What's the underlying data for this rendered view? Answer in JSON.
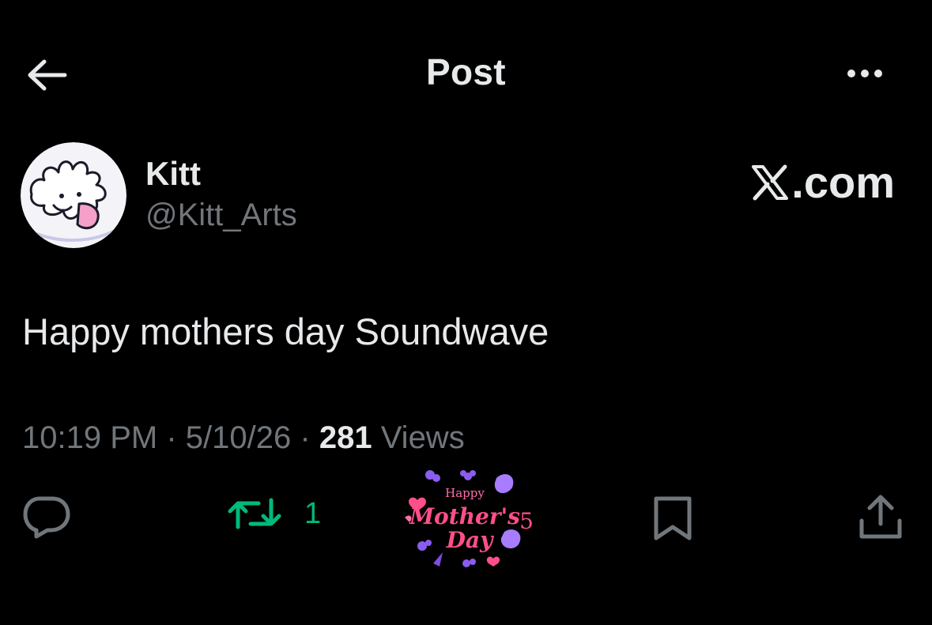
{
  "header": {
    "title": "Post",
    "back_icon": "arrow-left-icon",
    "more_icon": "more-horizontal-icon"
  },
  "author": {
    "display_name": "Kitt",
    "handle": "@Kitt_Arts",
    "avatar_icon": "avatar-cartoon-icon"
  },
  "watermark": {
    "text": ".com",
    "logo_icon": "x-logo-icon"
  },
  "post": {
    "text": "Happy mothers day Soundwave"
  },
  "meta": {
    "time": "10:19 PM",
    "separator": "·",
    "date": "5/10/26",
    "views_count": "281",
    "views_label": "Views"
  },
  "actions": {
    "reply_icon": "reply-bubble-icon",
    "repost_icon": "repost-icon",
    "repost_count": "1",
    "bookmark_icon": "bookmark-icon",
    "share_icon": "share-icon"
  },
  "sticker": {
    "line1": "Happy",
    "line2": "Mother's",
    "line3": "Day",
    "number": "5"
  },
  "colors": {
    "background": "#000000",
    "primary_text": "#e7e9ea",
    "secondary_text": "#71767b",
    "repost_green": "#00ba7c",
    "sticker_pink": "#ff4f8b",
    "sticker_purple": "#9b6bff"
  }
}
